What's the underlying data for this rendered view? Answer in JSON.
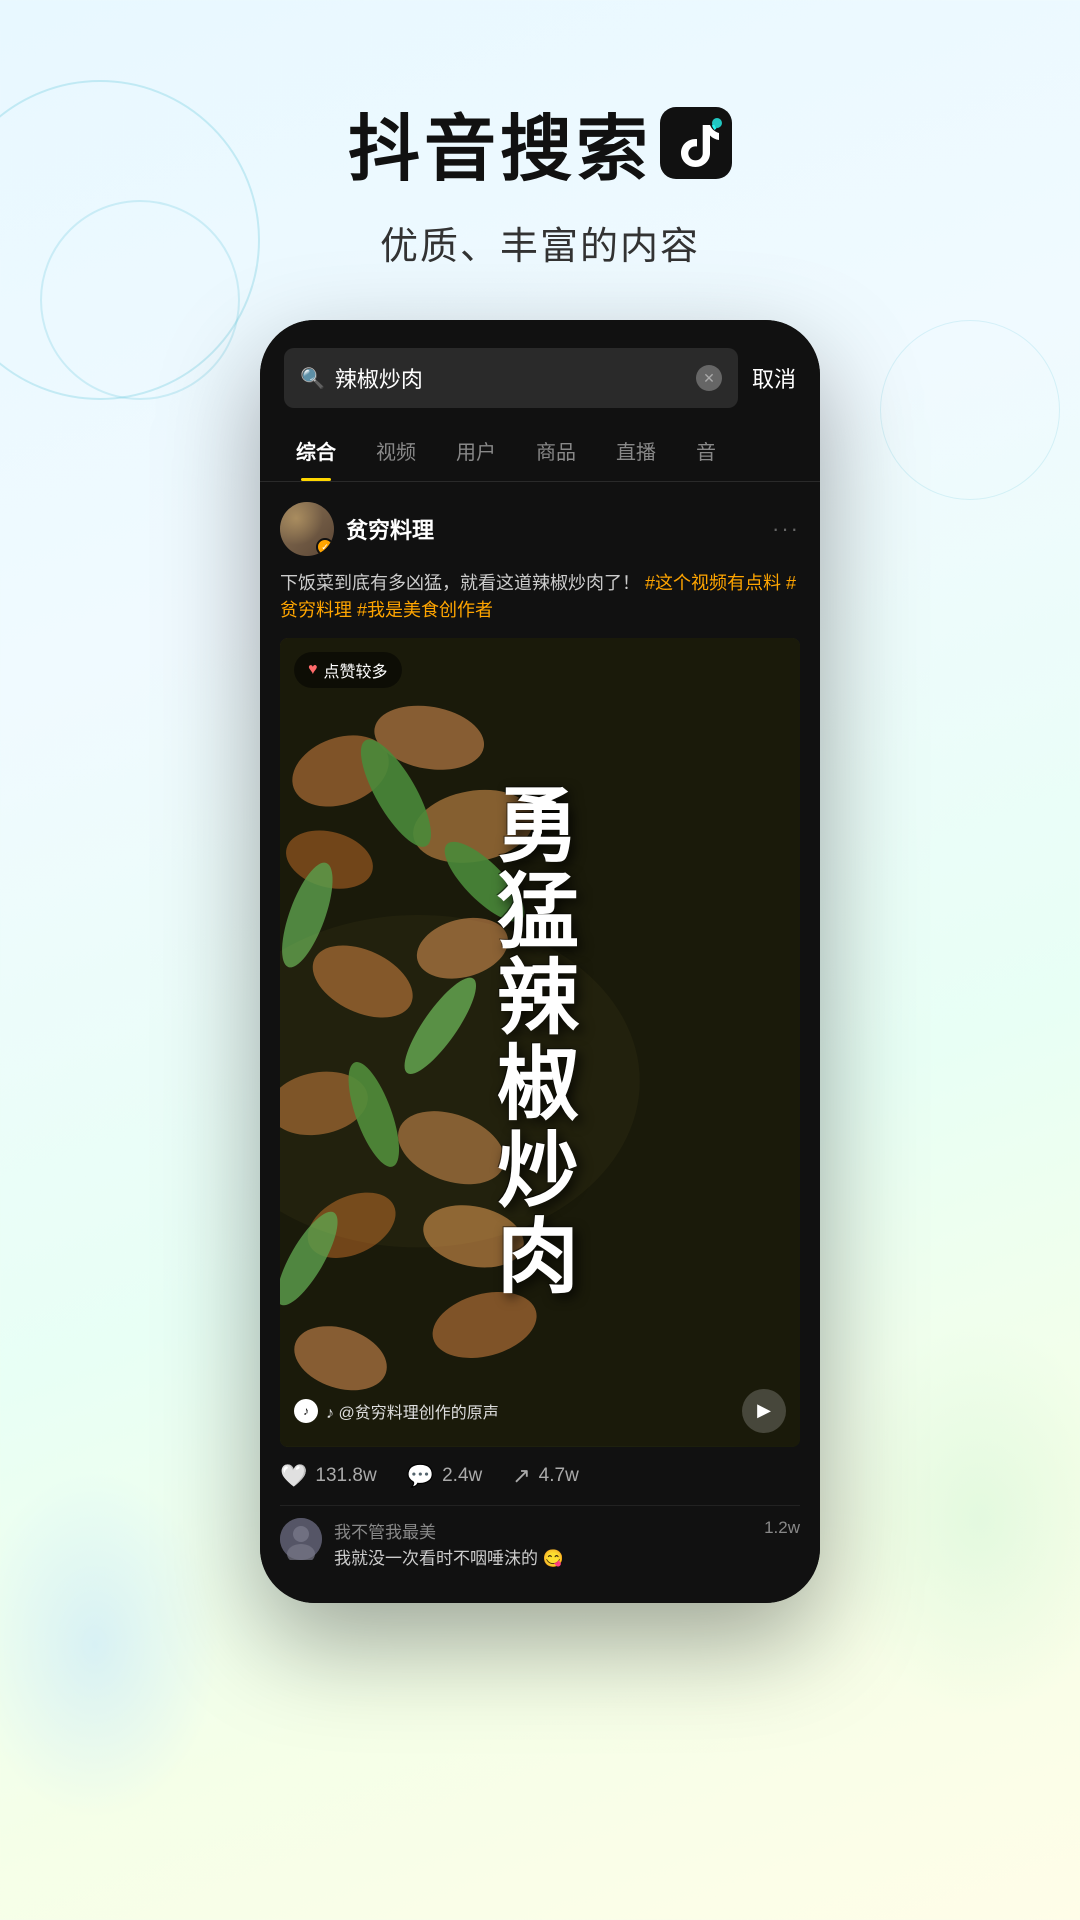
{
  "header": {
    "title": "抖音搜索",
    "subtitle": "优质、丰富的内容"
  },
  "phone": {
    "search": {
      "query": "辣椒炒肉",
      "cancel_label": "取消"
    },
    "tabs": [
      {
        "label": "综合",
        "active": true
      },
      {
        "label": "视频",
        "active": false
      },
      {
        "label": "用户",
        "active": false
      },
      {
        "label": "商品",
        "active": false
      },
      {
        "label": "直播",
        "active": false
      },
      {
        "label": "音",
        "active": false
      }
    ],
    "post": {
      "username": "贫穷料理",
      "verified": true,
      "description_normal": "下饭菜到底有多凶猛，就看这道辣椒炒肉了！",
      "description_highlight": "#这个视频有点料 #贫穷料理 #我是美食创作者",
      "likes_badge": "点赞较多",
      "video_text": "勇\n猛\n辣\n椒\n炒\n肉",
      "sound_info": "♪ @贫穷料理创作的原声",
      "engagement": {
        "likes": "131.8w",
        "comments": "2.4w",
        "shares": "4.7w"
      }
    },
    "comments": [
      {
        "name": "我不管我最美",
        "text": "我就没一次看时不咽唾沫的 😋",
        "count": "1.2w"
      }
    ]
  }
}
